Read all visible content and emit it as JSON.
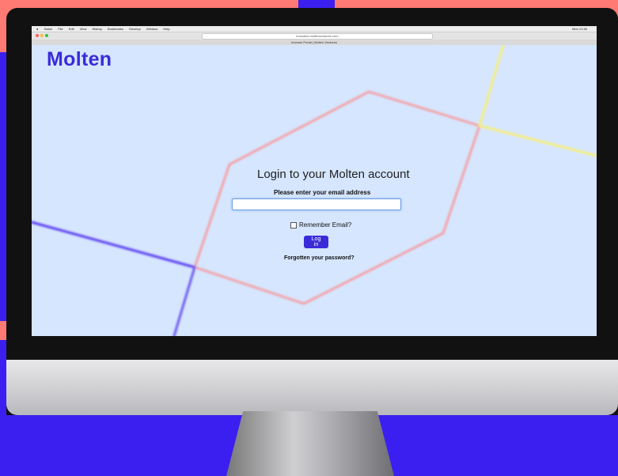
{
  "os": {
    "menu_items": [
      "Safari",
      "File",
      "Edit",
      "View",
      "History",
      "Bookmarks",
      "Develop",
      "Window",
      "Help"
    ],
    "clock": "Mon 21:56"
  },
  "browser": {
    "url": "investors.moltenventures.com",
    "tab_title": "Investor Portal | Molten Ventures"
  },
  "page": {
    "logo": "Molten",
    "title": "Login to your Molten account",
    "email_prompt": "Please enter your email address",
    "email_value": "",
    "remember_label": "Remember Email?",
    "login_label": "Log in",
    "forgot_label": "Forgotten your password?"
  },
  "colors": {
    "brand": "#3a2bd9",
    "background": "#d6e6ff",
    "hexagon_stroke": "#f4a0a4",
    "accent_yellow": "#f5ee7a"
  }
}
